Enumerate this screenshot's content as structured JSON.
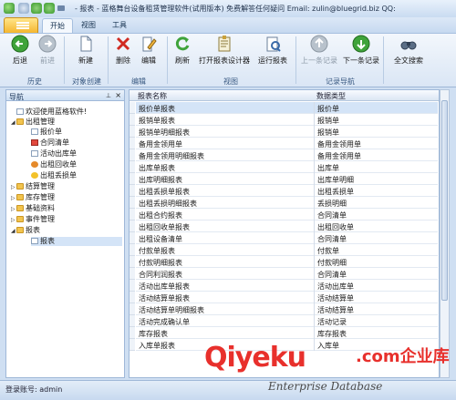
{
  "window": {
    "title": "- 报表 - 蓝格舞台设备租赁管理软件(试用版本) 免费解答任何疑问 Email: zulin@bluegrid.biz QQ:"
  },
  "menu_tabs": [
    "开始",
    "视图",
    "工具"
  ],
  "ribbon": {
    "buttons": [
      {
        "label": "后退",
        "disabled": false
      },
      {
        "label": "前进",
        "disabled": true
      },
      {
        "label": "新建",
        "disabled": false
      },
      {
        "label": "删除",
        "disabled": false
      },
      {
        "label": "编辑",
        "disabled": false
      },
      {
        "label": "刷新",
        "disabled": false
      },
      {
        "label": "打开报表设计器",
        "disabled": false
      },
      {
        "label": "运行报表",
        "disabled": false
      },
      {
        "label": "上一条记录",
        "disabled": true
      },
      {
        "label": "下一条记录",
        "disabled": false
      },
      {
        "label": "全文搜索",
        "disabled": false
      }
    ],
    "groups": [
      "历史",
      "对象创建",
      "编辑",
      "视图",
      "记录导航"
    ]
  },
  "nav": {
    "title": "导航",
    "tree": [
      {
        "label": "欢迎使用蓝格软件!",
        "icon": "document",
        "level": 0
      },
      {
        "label": "出租管理",
        "icon": "folder",
        "level": 0,
        "expanded": true
      },
      {
        "label": "报价单",
        "icon": "document",
        "level": 1
      },
      {
        "label": "合同清单",
        "icon": "red-document",
        "level": 1
      },
      {
        "label": "活动出库单",
        "icon": "document",
        "level": 1
      },
      {
        "label": "出租回收单",
        "icon": "recycle",
        "level": 1
      },
      {
        "label": "出租丢损单",
        "icon": "star",
        "level": 1
      },
      {
        "label": "结算管理",
        "icon": "folder",
        "level": 0
      },
      {
        "label": "库存管理",
        "icon": "folder",
        "level": 0
      },
      {
        "label": "基础资料",
        "icon": "folder",
        "level": 0
      },
      {
        "label": "事件管理",
        "icon": "folder",
        "level": 0
      },
      {
        "label": "报表",
        "icon": "folder",
        "level": 0,
        "expanded": true
      },
      {
        "label": "报表",
        "icon": "document",
        "level": 1,
        "selected": true
      }
    ]
  },
  "grid": {
    "columns": [
      "报表名称",
      "数据类型"
    ],
    "rows": [
      [
        "报价单报表",
        "报价单"
      ],
      [
        "报销单报表",
        "报销单"
      ],
      [
        "报销单明细报表",
        "报销单"
      ],
      [
        "备用金领用单",
        "备用金领用单"
      ],
      [
        "备用金领用明细报表",
        "备用金领用单"
      ],
      [
        "出库单报表",
        "出库单"
      ],
      [
        "出库明细报表",
        "出库单明细"
      ],
      [
        "出租丢损单报表",
        "出租丢损单"
      ],
      [
        "出租丢损明细报表",
        "丢损明细"
      ],
      [
        "出租合约报表",
        "合同清单"
      ],
      [
        "出租回收单报表",
        "出租回收单"
      ],
      [
        "出租设备清单",
        "合同清单"
      ],
      [
        "付款单报表",
        "付款单"
      ],
      [
        "付款明细报表",
        "付款明细"
      ],
      [
        "合同利润报表",
        "合同清单"
      ],
      [
        "活动出库单报表",
        "活动出库单"
      ],
      [
        "活动结算单报表",
        "活动结算单"
      ],
      [
        "活动结算单明细报表",
        "活动结算单"
      ],
      [
        "活动完成确认单",
        "活动记录"
      ],
      [
        "库存报表",
        "库存报表"
      ],
      [
        "入库单报表",
        "入库单"
      ]
    ]
  },
  "status": {
    "text": "登录账号: admin"
  },
  "watermark": {
    "brand": "Qiyeku",
    "suffix": ".com企业库",
    "tagline": "Enterprise Database"
  },
  "colors": {
    "accent": "#f5b62f",
    "selection": "#d4e4f7",
    "watermark": "#e8302c"
  }
}
